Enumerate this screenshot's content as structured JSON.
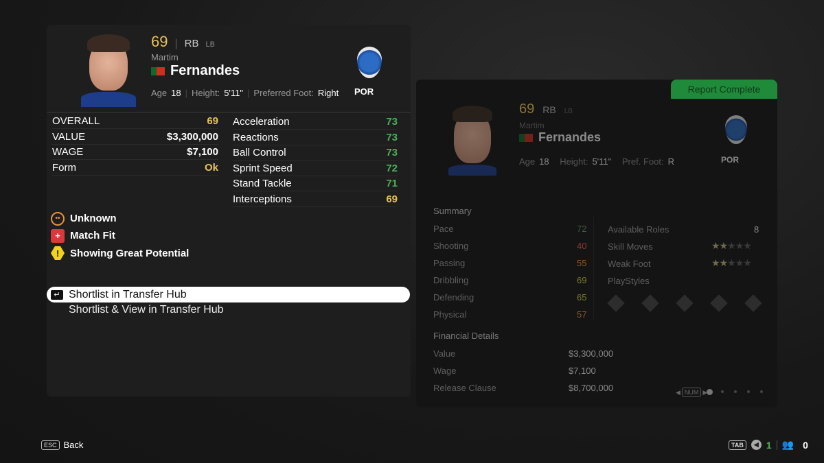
{
  "player": {
    "overall": "69",
    "position": "RB",
    "alt_position": "LB",
    "first_name": "Martim",
    "last_name": "Fernandes",
    "age_label": "Age",
    "age": "18",
    "height_label": "Height:",
    "height": "5'11\"",
    "foot_label": "Preferred Foot:",
    "foot": "Right",
    "club": "POR",
    "nationality": "Portugal"
  },
  "summary_left": [
    {
      "label": "OVERALL",
      "value": "69",
      "color": "#e8c25a"
    },
    {
      "label": "VALUE",
      "value": "$3,300,000",
      "color": "#ffffff"
    },
    {
      "label": "WAGE",
      "value": "$7,100",
      "color": "#ffffff"
    },
    {
      "label": "Form",
      "value": "Ok",
      "color": "#e8c25a"
    }
  ],
  "attributes": [
    {
      "label": "Acceleration",
      "value": "73",
      "color": "#4cb05a"
    },
    {
      "label": "Reactions",
      "value": "73",
      "color": "#4cb05a"
    },
    {
      "label": "Ball Control",
      "value": "73",
      "color": "#4cb05a"
    },
    {
      "label": "Sprint Speed",
      "value": "72",
      "color": "#4cb05a"
    },
    {
      "label": "Stand Tackle",
      "value": "71",
      "color": "#4cb05a"
    },
    {
      "label": "Interceptions",
      "value": "69",
      "color": "#e8c25a"
    }
  ],
  "statuses": [
    {
      "icon": "neutral-face-icon",
      "label": "Unknown"
    },
    {
      "icon": "ambulance-icon",
      "label": "Match Fit"
    },
    {
      "icon": "warning-icon",
      "label": "Showing Great Potential"
    }
  ],
  "menu": {
    "item1": "Shortlist in Transfer Hub",
    "item2": "Shortlist & View in Transfer Hub"
  },
  "report": {
    "badge": "Report Complete",
    "badge_color": "#1f8a3a",
    "foot_label": "Pref. Foot:",
    "foot": "R",
    "summary_title": "Summary",
    "summary": [
      {
        "label": "Pace",
        "value": "72",
        "color": "#3e5a44"
      },
      {
        "label": "Shooting",
        "value": "40",
        "color": "#8a3a32"
      },
      {
        "label": "Passing",
        "value": "55",
        "color": "#8a5a2a"
      },
      {
        "label": "Dribbling",
        "value": "69",
        "color": "#7a7a2a"
      },
      {
        "label": "Defending",
        "value": "65",
        "color": "#7a7a2a"
      },
      {
        "label": "Physical",
        "value": "57",
        "color": "#8a5a2a"
      }
    ],
    "roles_label": "Available Roles",
    "roles": "8",
    "skill_label": "Skill Moves",
    "skill_stars": 2,
    "weak_label": "Weak Foot",
    "weak_stars": 2,
    "playstyles_label": "PlayStyles",
    "financial_title": "Financial Details",
    "financial": [
      {
        "label": "Value",
        "value": "$3,300,000"
      },
      {
        "label": "Wage",
        "value": "$7,100"
      },
      {
        "label": "Release Clause",
        "value": "$8,700,000"
      }
    ],
    "pager_key": "NUM",
    "pages": 5,
    "current_page": 1
  },
  "footer": {
    "back_key": "ESC",
    "back": "Back",
    "tab_key": "TAB",
    "count1": "1",
    "count2": "0"
  }
}
